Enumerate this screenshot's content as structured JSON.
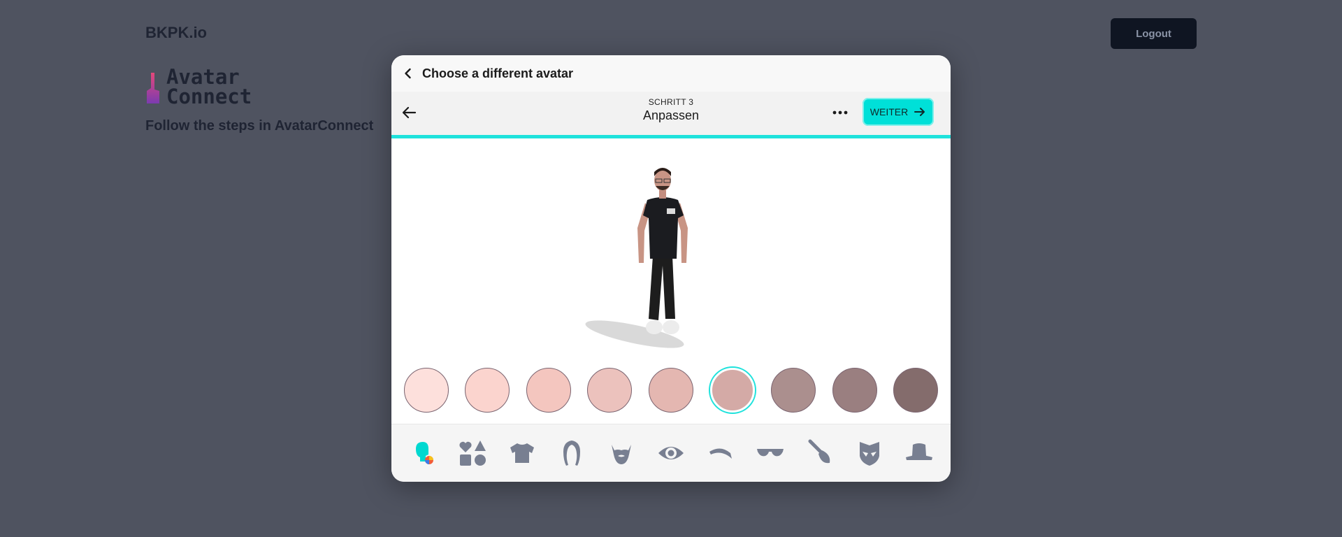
{
  "page": {
    "brand": "BKPK.io",
    "logout_label": "Logout",
    "logo_line1": "Avatar",
    "logo_line2": "Connect",
    "subtitle": "Follow the steps in AvatarConnect"
  },
  "modal": {
    "title": "Choose a different avatar",
    "step_label": "SCHRITT 3",
    "step_name": "Anpassen",
    "next_label": "WEITER"
  },
  "colors": {
    "accent": "#1fe2dc",
    "button": "#00e0d8",
    "background": "#4f5360",
    "icon_gray": "#787f91"
  },
  "skin_tones": [
    {
      "color": "#fde0dc",
      "selected": false
    },
    {
      "color": "#fbd4ce",
      "selected": false
    },
    {
      "color": "#f4c6bf",
      "selected": false
    },
    {
      "color": "#ecc2bd",
      "selected": false
    },
    {
      "color": "#e4b7b1",
      "selected": false
    },
    {
      "color": "#d4aaa6",
      "selected": true
    },
    {
      "color": "#ab8f8e",
      "selected": false
    },
    {
      "color": "#9a7f80",
      "selected": false
    },
    {
      "color": "#846c6c",
      "selected": false
    }
  ],
  "categories": [
    {
      "icon": "skin-color-icon",
      "active": true
    },
    {
      "icon": "shapes-icon",
      "active": false
    },
    {
      "icon": "shirt-icon",
      "active": false
    },
    {
      "icon": "hair-icon",
      "active": false
    },
    {
      "icon": "beard-icon",
      "active": false
    },
    {
      "icon": "eye-icon",
      "active": false
    },
    {
      "icon": "eyebrow-icon",
      "active": false
    },
    {
      "icon": "glasses-icon",
      "active": false
    },
    {
      "icon": "makeup-brush-icon",
      "active": false
    },
    {
      "icon": "face-mask-icon",
      "active": false
    },
    {
      "icon": "hat-icon",
      "active": false
    }
  ]
}
